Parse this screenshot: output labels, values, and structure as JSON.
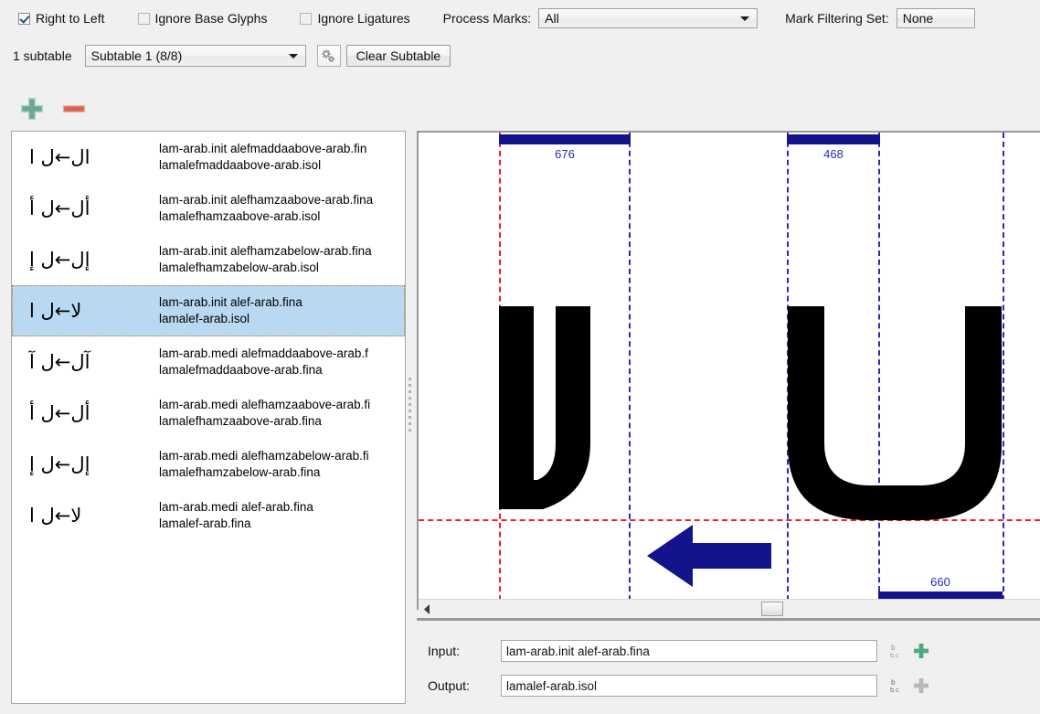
{
  "toolbar": {
    "checkboxes": [
      {
        "label": "Right to Left",
        "checked": true,
        "name": "right-to-left"
      },
      {
        "label": "Ignore Base Glyphs",
        "checked": false,
        "name": "ignore-base-glyphs"
      },
      {
        "label": "Ignore Ligatures",
        "checked": false,
        "name": "ignore-ligatures"
      }
    ],
    "process_marks_label": "Process Marks:",
    "process_marks_value": "All",
    "mark_filtering_label": "Mark Filtering Set:",
    "mark_filtering_value": "None",
    "subtable_count_label": "1 subtable",
    "subtable_value": "Subtable 1 (8/8)",
    "clear_subtable_label": "Clear Subtable",
    "gear_icon": "gear-icon",
    "add_icon": "plus-icon",
    "remove_icon": "minus-icon"
  },
  "list": {
    "rows": [
      {
        "glyph_preview": "ال←ل ا",
        "line1": "lam-arab.init alefmaddaabove-arab.fin",
        "line2": "lamalefmaddaabove-arab.isol",
        "selected": false
      },
      {
        "glyph_preview": "أل←ل أ",
        "line1": "lam-arab.init alefhamzaabove-arab.fina",
        "line2": "lamalefhamzaabove-arab.isol",
        "selected": false
      },
      {
        "glyph_preview": "إل←ل إ",
        "line1": "lam-arab.init alefhamzabelow-arab.fina",
        "line2": "lamalefhamzabelow-arab.isol",
        "selected": false
      },
      {
        "glyph_preview": "لا←ل ا",
        "line1": "lam-arab.init alef-arab.fina",
        "line2": "lamalef-arab.isol",
        "selected": true
      },
      {
        "glyph_preview": "آل←ل آ",
        "line1": "lam-arab.medi alefmaddaabove-arab.f",
        "line2": "lamalefmaddaabove-arab.fina",
        "selected": false
      },
      {
        "glyph_preview": "أل←ل أ",
        "line1": "lam-arab.medi alefhamzaabove-arab.fi",
        "line2": "lamalefhamzaabove-arab.fina",
        "selected": false
      },
      {
        "glyph_preview": "إل←ل إ",
        "line1": "lam-arab.medi alefhamzabelow-arab.fi",
        "line2": "lamalefhamzabelow-arab.fina",
        "selected": false
      },
      {
        "glyph_preview": "لا←ل ا",
        "line1": "lam-arab.medi alef-arab.fina",
        "line2": "lamalef-arab.fina",
        "selected": false
      }
    ]
  },
  "preview": {
    "measures": [
      {
        "value": "676",
        "name": "advance-width-676"
      },
      {
        "value": "468",
        "name": "advance-width-468"
      },
      {
        "value": "660",
        "name": "advance-width-660"
      }
    ],
    "result_glyph": "لا",
    "source_glyph": "ل",
    "arrow_icon": "left-arrow-icon",
    "colors": {
      "guide_blue": "#2b2bbb",
      "guide_red": "#f02020",
      "measure_bar": "#13138c",
      "glyph": "#000000"
    }
  },
  "scrollbar": {
    "left_arrow_icon": "scroll-left-arrow-icon",
    "thumb_name": "horizontal-scroll-thumb"
  },
  "io": {
    "input_label": "Input:",
    "input_value": "lam-arab.init alef-arab.fina",
    "output_label": "Output:",
    "output_value": "lamalef-arab.isol",
    "bc_icon": "glyph-name-toggle-icon",
    "add_icon": "plus-icon"
  }
}
